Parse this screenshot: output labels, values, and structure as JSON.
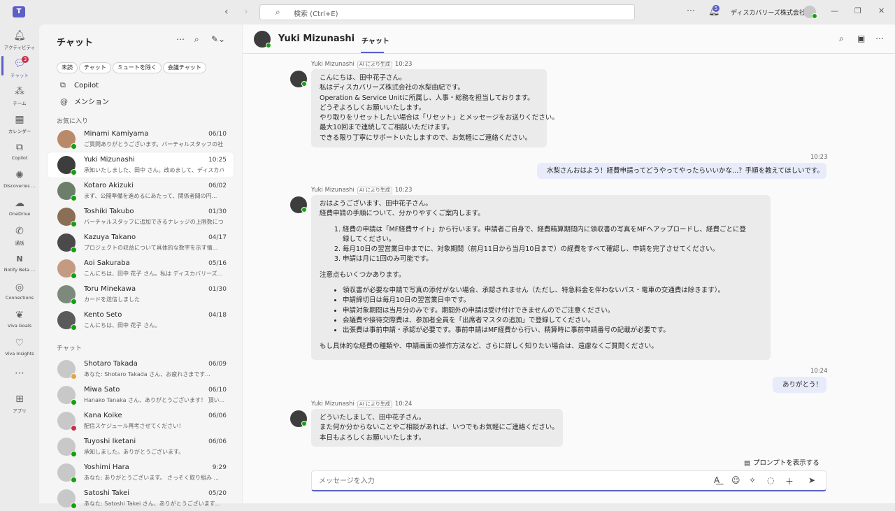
{
  "titlebar": {
    "logo": "T",
    "search_placeholder": "検索 (Ctrl+E)",
    "more": "⋯",
    "notif_badge": "5",
    "org": "ディスカバリーズ株式会社",
    "back": "‹",
    "forward": "›",
    "minimize": "—",
    "restore": "❐",
    "close": "✕"
  },
  "rail": [
    {
      "label": "アクティビティ",
      "icon": "bell-icon"
    },
    {
      "label": "チャット",
      "icon": "chat-icon",
      "badge": "3",
      "active": true
    },
    {
      "label": "チーム",
      "icon": "teams-icon"
    },
    {
      "label": "カレンダー",
      "icon": "calendar-icon"
    },
    {
      "label": "Copilot",
      "icon": "copilot-icon"
    },
    {
      "label": "Discoveries ...",
      "icon": "discoveries-icon"
    },
    {
      "label": "OneDrive",
      "icon": "cloud-icon"
    },
    {
      "label": "通話",
      "icon": "phone-icon"
    },
    {
      "label": "Notify Beta ...",
      "icon": "notify-icon"
    },
    {
      "label": "Connections",
      "icon": "connections-icon"
    },
    {
      "label": "Viva Goals",
      "icon": "goals-icon"
    },
    {
      "label": "Viva Insights",
      "icon": "insights-icon"
    },
    {
      "label": "",
      "icon": "more-icon"
    },
    {
      "label": "アプリ",
      "icon": "apps-icon"
    }
  ],
  "chatlist": {
    "title": "チャット",
    "filters": [
      "未読",
      "チャット",
      "ミュートを除く",
      "会議チャット"
    ],
    "copilot": "Copilot",
    "mention": "メンション",
    "favorites_label": "お気に入り",
    "chats_label": "チャット",
    "favorites": [
      {
        "name": "Minami Kamiyama",
        "time": "06/10",
        "preview": "ご質問ありがとうございます。バーチャルスタッフの社...",
        "color": "#b98a6a"
      },
      {
        "name": "Yuki Mizunashi",
        "time": "10:25",
        "preview": "承知いたしました、田中 さん。改めまして、ディスカバ...",
        "color": "#3d3d3d",
        "selected": true
      },
      {
        "name": "Kotaro Akizuki",
        "time": "06/02",
        "preview": "まず、公開準備を進めるにあたって、関係者間の円...",
        "color": "#6b7f6a"
      },
      {
        "name": "Toshiki Takubo",
        "time": "01/30",
        "preview": "バーチャルスタッフに追加できるナレッジの上限数につ...",
        "color": "#8a6e55"
      },
      {
        "name": "Kazuya Takano",
        "time": "04/17",
        "preview": "プロジェクトの収益について具体的な数字を示す情...",
        "color": "#4a4a4a"
      },
      {
        "name": "Aoi Sakuraba",
        "time": "05/16",
        "preview": "こんにちは、田中 花子 さん。私は ディスカバリーズ...",
        "color": "#c49a80"
      },
      {
        "name": "Toru Minekawa",
        "time": "01/30",
        "preview": "カードを送信しました",
        "color": "#7b8a7a"
      },
      {
        "name": "Kento Seto",
        "time": "04/18",
        "preview": "こんにちは、田中 花子 さん。",
        "color": "#5a5a5a"
      }
    ],
    "chats": [
      {
        "name": "Shotaro Takada",
        "time": "06/09",
        "preview": "あなた: Shotaro Takada さん、お疲れさまです...",
        "status": "#e8a33d"
      },
      {
        "name": "Miwa Sato",
        "time": "06/10",
        "preview": "Hanako Tanaka さん、ありがとうございます！ 頂い...",
        "status": "#13a10e"
      },
      {
        "name": "Kana Koike",
        "time": "06/06",
        "preview": "配信スケジュール再考させてください！",
        "status": "#c4314b"
      },
      {
        "name": "Tuyoshi Iketani",
        "time": "06/06",
        "preview": "承知しました。ありがとうございます。",
        "status": "#13a10e"
      },
      {
        "name": "Yoshimi Hara",
        "time": "9:29",
        "preview": "あなた: ありがとうございます。 さっそく取り組み ...",
        "status": "#13a10e"
      },
      {
        "name": "Satoshi Takei",
        "time": "05/20",
        "preview": "あなた: Satoshi Takei さん、ありがとうございます...",
        "status": "#13a10e"
      }
    ]
  },
  "conversation": {
    "contact": "Yuki Mizunashi",
    "tab": "チャット",
    "ai_tag": "AI により生成",
    "prompt_link": "プロンプトを表示する",
    "compose_placeholder": "メッセージを入力",
    "messages": [
      {
        "sender": "Yuki Mizunashi",
        "time": "10:23",
        "lines": [
          "こんにちは、田中花子さん。",
          "私はディスカバリーズ株式会社の水梨由紀です。",
          "Operation & Service Unitに所属し、人事・総務を担当しております。",
          "どうぞよろしくお願いいたします。",
          "やり取りをリセットしたい場合は「リセット」とメッセージをお送りください。",
          "最大10回まで連続してご相談いただけます。",
          "できる限り丁寧にサポートいたしますので、お気軽にご連絡ください。"
        ]
      },
      {
        "me": true,
        "time": "10:23",
        "text": "水梨さんおはよう！経費申請ってどうやってやったらいいかな...？手順を教えてほしいです。"
      },
      {
        "sender": "Yuki Mizunashi",
        "time": "10:23",
        "intro": [
          "おはようございます、田中花子さん。",
          "経費申請の手順について、分かりやすくご案内します。"
        ],
        "steps": [
          "経費の申請は「MF経費サイト」から行います。申請者ご自身で、経費精算期間内に領収書の写真をMFへアップロードし、経費ごとに登",
          "録してください。",
          "毎月10日の翌営業日中までに、対象期間（前月11日から当月10日まで）の経費をすべて確認し、申請を完了させてください。",
          "申請は月に1回のみ可能です。"
        ],
        "notes_title": "注意点もいくつかあります。",
        "notes": [
          "領収書が必要な申請で写真の添付がない場合、承認されません（ただし、特急料金を伴わないバス・電車の交通費は除きます）。",
          "申請締切日は毎月10日の翌営業日中です。",
          "申請対象期間は当月分のみです。期間外の申請は受け付けできませんのでご注意ください。",
          "会議費や接待交際費は、参加者全員を「出席者マスタの追加」で登録してください。",
          "出張費は事前申請・承認が必要です。事前申請はMF経費から行い、精算時に事前申請番号の記載が必要です。"
        ],
        "closing": "もし具体的な経費の種類や、申請画面の操作方法など、さらに詳しく知りたい場合は、遠慮なくご質問ください。"
      },
      {
        "me": true,
        "time": "10:24",
        "text": "ありがとう！"
      },
      {
        "sender": "Yuki Mizunashi",
        "time": "10:24",
        "lines": [
          "どういたしまして、田中花子さん。",
          "また何か分からないことやご相談があれば、いつでもお気軽にご連絡ください。",
          "本日もよろしくお願いいたします。"
        ]
      }
    ]
  },
  "colors": {
    "accent": "#5b5fc7",
    "available": "#13a10e",
    "away": "#e8a33d",
    "busy": "#c4314b"
  }
}
